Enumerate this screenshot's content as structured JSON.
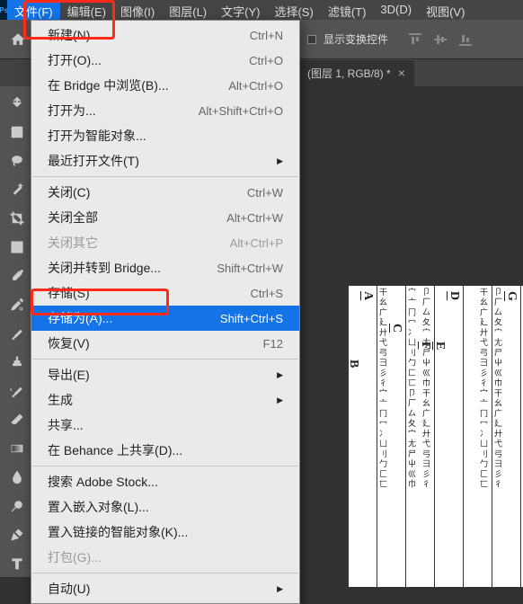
{
  "menubar": {
    "items": [
      {
        "label": "文件(F)",
        "active": true
      },
      {
        "label": "编辑(E)"
      },
      {
        "label": "图像(I)"
      },
      {
        "label": "图层(L)"
      },
      {
        "label": "文字(Y)"
      },
      {
        "label": "选择(S)"
      },
      {
        "label": "滤镜(T)"
      },
      {
        "label": "3D(D)"
      },
      {
        "label": "视图(V)"
      }
    ]
  },
  "options": {
    "show_transform_controls": "显示变换控件"
  },
  "tab": {
    "title": "(图层 1, RGB/8) *"
  },
  "dropdown": [
    {
      "type": "item",
      "label": "新建(N)...",
      "shortcut": "Ctrl+N"
    },
    {
      "type": "item",
      "label": "打开(O)...",
      "shortcut": "Ctrl+O"
    },
    {
      "type": "item",
      "label": "在 Bridge 中浏览(B)...",
      "shortcut": "Alt+Ctrl+O"
    },
    {
      "type": "item",
      "label": "打开为...",
      "shortcut": "Alt+Shift+Ctrl+O"
    },
    {
      "type": "item",
      "label": "打开为智能对象..."
    },
    {
      "type": "item",
      "label": "最近打开文件(T)",
      "submenu": true
    },
    {
      "type": "sep"
    },
    {
      "type": "item",
      "label": "关闭(C)",
      "shortcut": "Ctrl+W"
    },
    {
      "type": "item",
      "label": "关闭全部",
      "shortcut": "Alt+Ctrl+W"
    },
    {
      "type": "item",
      "label": "关闭其它",
      "shortcut": "Alt+Ctrl+P",
      "disabled": true
    },
    {
      "type": "item",
      "label": "关闭并转到 Bridge...",
      "shortcut": "Shift+Ctrl+W"
    },
    {
      "type": "item",
      "label": "存储(S)",
      "shortcut": "Ctrl+S"
    },
    {
      "type": "item",
      "label": "存储为(A)...",
      "shortcut": "Shift+Ctrl+S",
      "highlighted": true
    },
    {
      "type": "item",
      "label": "恢复(V)",
      "shortcut": "F12"
    },
    {
      "type": "sep"
    },
    {
      "type": "item",
      "label": "导出(E)",
      "submenu": true
    },
    {
      "type": "item",
      "label": "生成",
      "submenu": true
    },
    {
      "type": "item",
      "label": "共享..."
    },
    {
      "type": "item",
      "label": "在 Behance 上共享(D)..."
    },
    {
      "type": "sep"
    },
    {
      "type": "item",
      "label": "搜索 Adobe Stock..."
    },
    {
      "type": "item",
      "label": "置入嵌入对象(L)..."
    },
    {
      "type": "item",
      "label": "置入链接的智能对象(K)..."
    },
    {
      "type": "item",
      "label": "打包(G)...",
      "disabled": true
    },
    {
      "type": "sep"
    },
    {
      "type": "item",
      "label": "自动(U)",
      "submenu": true
    }
  ],
  "canvas": {
    "letters": [
      "A",
      "B",
      "C",
      "D",
      "E",
      "F",
      "G"
    ]
  }
}
